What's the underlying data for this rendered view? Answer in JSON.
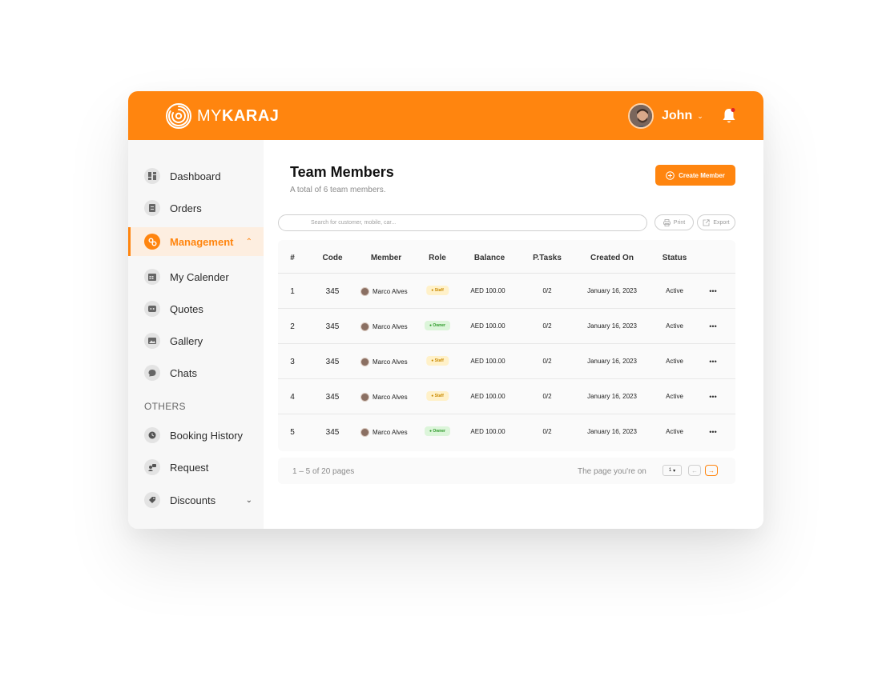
{
  "app": {
    "brand_prefix": "MY",
    "brand_suffix": "KARAJ",
    "accent_color": "#ff850f"
  },
  "header": {
    "user_name": "John",
    "user_icon": "chevron-down-icon",
    "bell_icon": "bell-icon"
  },
  "sidebar": {
    "items": [
      {
        "label": "Dashboard",
        "icon": "dashboard-icon"
      },
      {
        "label": "Orders",
        "icon": "orders-icon"
      },
      {
        "label": "Management",
        "icon": "management-icon",
        "active": true
      },
      {
        "label": "My Calender",
        "icon": "calendar-icon"
      },
      {
        "label": "Quotes",
        "icon": "quotes-icon"
      },
      {
        "label": "Gallery",
        "icon": "gallery-icon"
      },
      {
        "label": "Chats",
        "icon": "chat-icon"
      }
    ],
    "section_label": "OTHERS",
    "other_items": [
      {
        "label": "Booking History",
        "icon": "clock-icon"
      },
      {
        "label": "Request",
        "icon": "request-icon"
      },
      {
        "label": "Discounts",
        "icon": "tag-icon"
      }
    ]
  },
  "main": {
    "title": "Team Members",
    "subtitle": "A total of 6 team members.",
    "create_button": "Create Member",
    "search_placeholder": "Search for customer, mobile, car...",
    "print_label": "Print",
    "export_label": "Export"
  },
  "table": {
    "columns": [
      "#",
      "Code",
      "Member",
      "Role",
      "Balance",
      "P.Tasks",
      "Created On",
      "Status"
    ],
    "rows": [
      {
        "num": "1",
        "code": "345",
        "member": "Marco Alves",
        "role": "Staff",
        "balance": "AED 100.00",
        "tasks": "0/2",
        "created": "January 16, 2023",
        "status": "Active"
      },
      {
        "num": "2",
        "code": "345",
        "member": "Marco Alves",
        "role": "Owner",
        "balance": "AED 100.00",
        "tasks": "0/2",
        "created": "January 16, 2023",
        "status": "Active"
      },
      {
        "num": "3",
        "code": "345",
        "member": "Marco Alves",
        "role": "Staff",
        "balance": "AED 100.00",
        "tasks": "0/2",
        "created": "January 16, 2023",
        "status": "Active"
      },
      {
        "num": "4",
        "code": "345",
        "member": "Marco Alves",
        "role": "Staff",
        "balance": "AED 100.00",
        "tasks": "0/2",
        "created": "January 16, 2023",
        "status": "Active"
      },
      {
        "num": "5",
        "code": "345",
        "member": "Marco Alves",
        "role": "Owner",
        "balance": "AED 100.00",
        "tasks": "0/2",
        "created": "January 16, 2023",
        "status": "Active"
      }
    ],
    "more_label": "•••"
  },
  "pagination": {
    "summary": "1 – 5 of 20 pages",
    "page_label": "The page you're on",
    "current_page": "1",
    "prev_symbol": "←",
    "next_symbol": "→"
  }
}
